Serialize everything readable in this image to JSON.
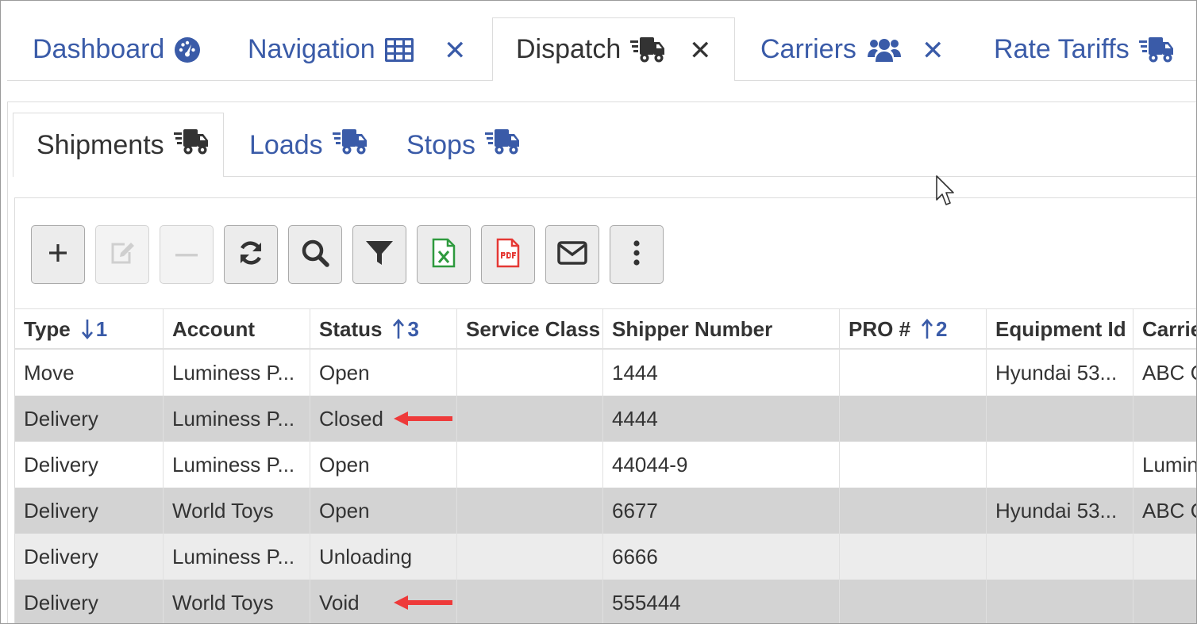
{
  "top_tabs": [
    {
      "label": "Dashboard",
      "icon": "tachometer-icon",
      "closable": false,
      "active": false
    },
    {
      "label": "Navigation",
      "icon": "grid-icon",
      "closable": true,
      "active": false
    },
    {
      "label": "Dispatch",
      "icon": "truck-icon",
      "closable": true,
      "active": true
    },
    {
      "label": "Carriers",
      "icon": "users-icon",
      "closable": true,
      "active": false
    },
    {
      "label": "Rate Tariffs",
      "icon": "truck-icon",
      "closable": false,
      "active": false
    }
  ],
  "close_glyph": "✕",
  "sub_tabs": [
    {
      "label": "Shipments",
      "icon": "truck-icon",
      "active": true
    },
    {
      "label": "Loads",
      "icon": "truck-icon",
      "active": false
    },
    {
      "label": "Stops",
      "icon": "truck-icon",
      "active": false
    }
  ],
  "toolbar": [
    {
      "name": "add-button",
      "icon": "plus-icon",
      "disabled": false
    },
    {
      "name": "edit-button",
      "icon": "edit-icon",
      "disabled": true
    },
    {
      "name": "remove-button",
      "icon": "minus-icon",
      "disabled": true
    },
    {
      "name": "refresh-button",
      "icon": "refresh-icon",
      "disabled": false
    },
    {
      "name": "search-button",
      "icon": "search-icon",
      "disabled": false
    },
    {
      "name": "filter-button",
      "icon": "filter-icon",
      "disabled": false
    },
    {
      "name": "export-excel-button",
      "icon": "excel-file-icon",
      "disabled": false
    },
    {
      "name": "export-pdf-button",
      "icon": "pdf-file-icon",
      "disabled": false
    },
    {
      "name": "email-button",
      "icon": "envelope-icon",
      "disabled": false
    },
    {
      "name": "more-button",
      "icon": "more-vertical-icon",
      "disabled": false
    }
  ],
  "table": {
    "columns": [
      {
        "label": "Type",
        "sort_direction": "down",
        "sort_order": "1"
      },
      {
        "label": "Account",
        "sort_direction": "",
        "sort_order": ""
      },
      {
        "label": "Status",
        "sort_direction": "up",
        "sort_order": "3"
      },
      {
        "label": "Service Class",
        "sort_direction": "",
        "sort_order": ""
      },
      {
        "label": "Shipper Number",
        "sort_direction": "",
        "sort_order": ""
      },
      {
        "label": "PRO #",
        "sort_direction": "up",
        "sort_order": "2"
      },
      {
        "label": "Equipment Id",
        "sort_direction": "",
        "sort_order": ""
      },
      {
        "label": "Carrie",
        "sort_direction": "",
        "sort_order": ""
      }
    ],
    "rows": [
      {
        "cells": [
          "Move",
          "Luminess P...",
          "Open",
          "",
          "1444",
          "",
          "Hyundai 53...",
          "ABC C"
        ],
        "highlight": "none",
        "annotated": false
      },
      {
        "cells": [
          "Delivery",
          "Luminess P...",
          "Closed",
          "",
          "4444",
          "",
          "",
          ""
        ],
        "highlight": "dark",
        "annotated": true
      },
      {
        "cells": [
          "Delivery",
          "Luminess P...",
          "Open",
          "",
          "44044-9",
          "",
          "",
          "Lumin"
        ],
        "highlight": "none",
        "annotated": false
      },
      {
        "cells": [
          "Delivery",
          "World Toys",
          "Open",
          "",
          "6677",
          "",
          "Hyundai 53...",
          "ABC C"
        ],
        "highlight": "dark",
        "annotated": false
      },
      {
        "cells": [
          "Delivery",
          "Luminess P...",
          "Unloading",
          "",
          "6666",
          "",
          "",
          ""
        ],
        "highlight": "light",
        "annotated": false
      },
      {
        "cells": [
          "Delivery",
          "World Toys",
          "Void",
          "",
          "555444",
          "",
          "",
          ""
        ],
        "highlight": "dark",
        "annotated": true
      }
    ]
  },
  "colors": {
    "accent": "#3a5ba8",
    "row_dark": "#d3d3d3",
    "row_light": "#ececec",
    "annotation_arrow": "#ee3a3a"
  }
}
